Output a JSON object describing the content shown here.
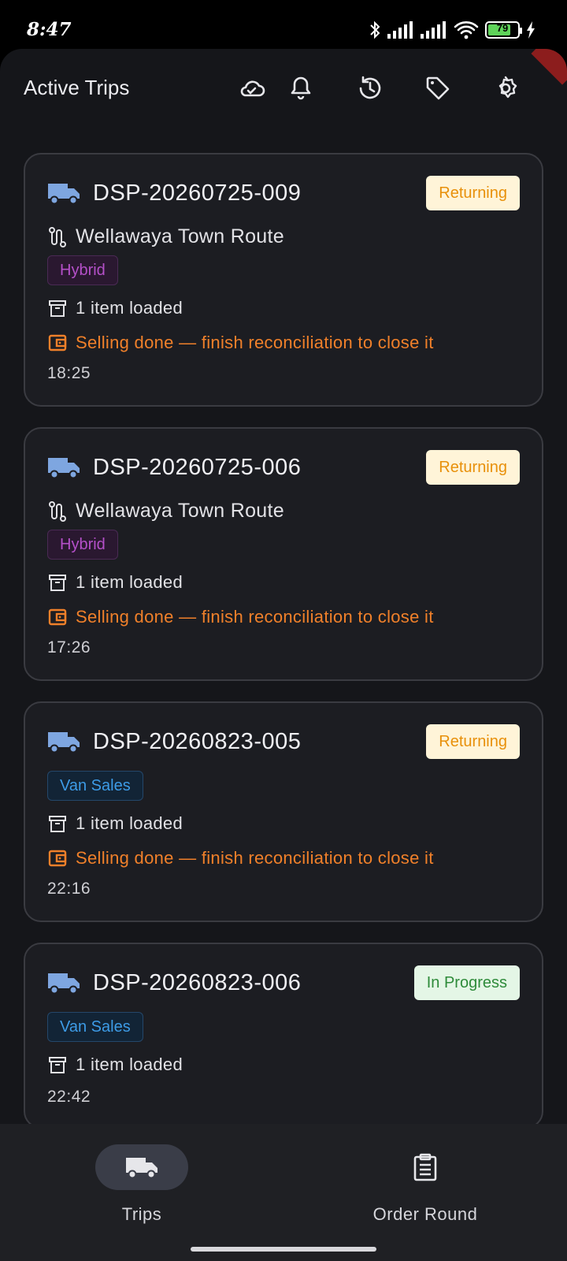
{
  "status_bar": {
    "time": "8:47",
    "battery_level": "79"
  },
  "header": {
    "title": "Active Trips"
  },
  "trips": [
    {
      "id": "DSP-20260725-009",
      "status": "Returning",
      "route": "Wellawaya Town Route",
      "type": "Hybrid",
      "items": "1 item loaded",
      "warning": "Selling done — finish reconciliation to close it",
      "time": "18:25"
    },
    {
      "id": "DSP-20260725-006",
      "status": "Returning",
      "route": "Wellawaya Town Route",
      "type": "Hybrid",
      "items": "1 item loaded",
      "warning": "Selling done — finish reconciliation to close it",
      "time": "17:26"
    },
    {
      "id": "DSP-20260823-005",
      "status": "Returning",
      "type": "Van Sales",
      "items": "1 item loaded",
      "warning": "Selling done — finish reconciliation to close it",
      "time": "22:16"
    },
    {
      "id": "DSP-20260823-006",
      "status": "In Progress",
      "type": "Van Sales",
      "items": "1 item loaded",
      "time": "22:42"
    }
  ],
  "bottom_nav": {
    "trips_label": "Trips",
    "order_round_label": "Order Round"
  },
  "colors": {
    "returning": "#e8900a",
    "in_progress": "#2e8b3a",
    "hybrid": "#b550c9",
    "van_sales": "#3d9be6",
    "warning": "#f0802a",
    "truck_icon": "#7ea6e0"
  }
}
